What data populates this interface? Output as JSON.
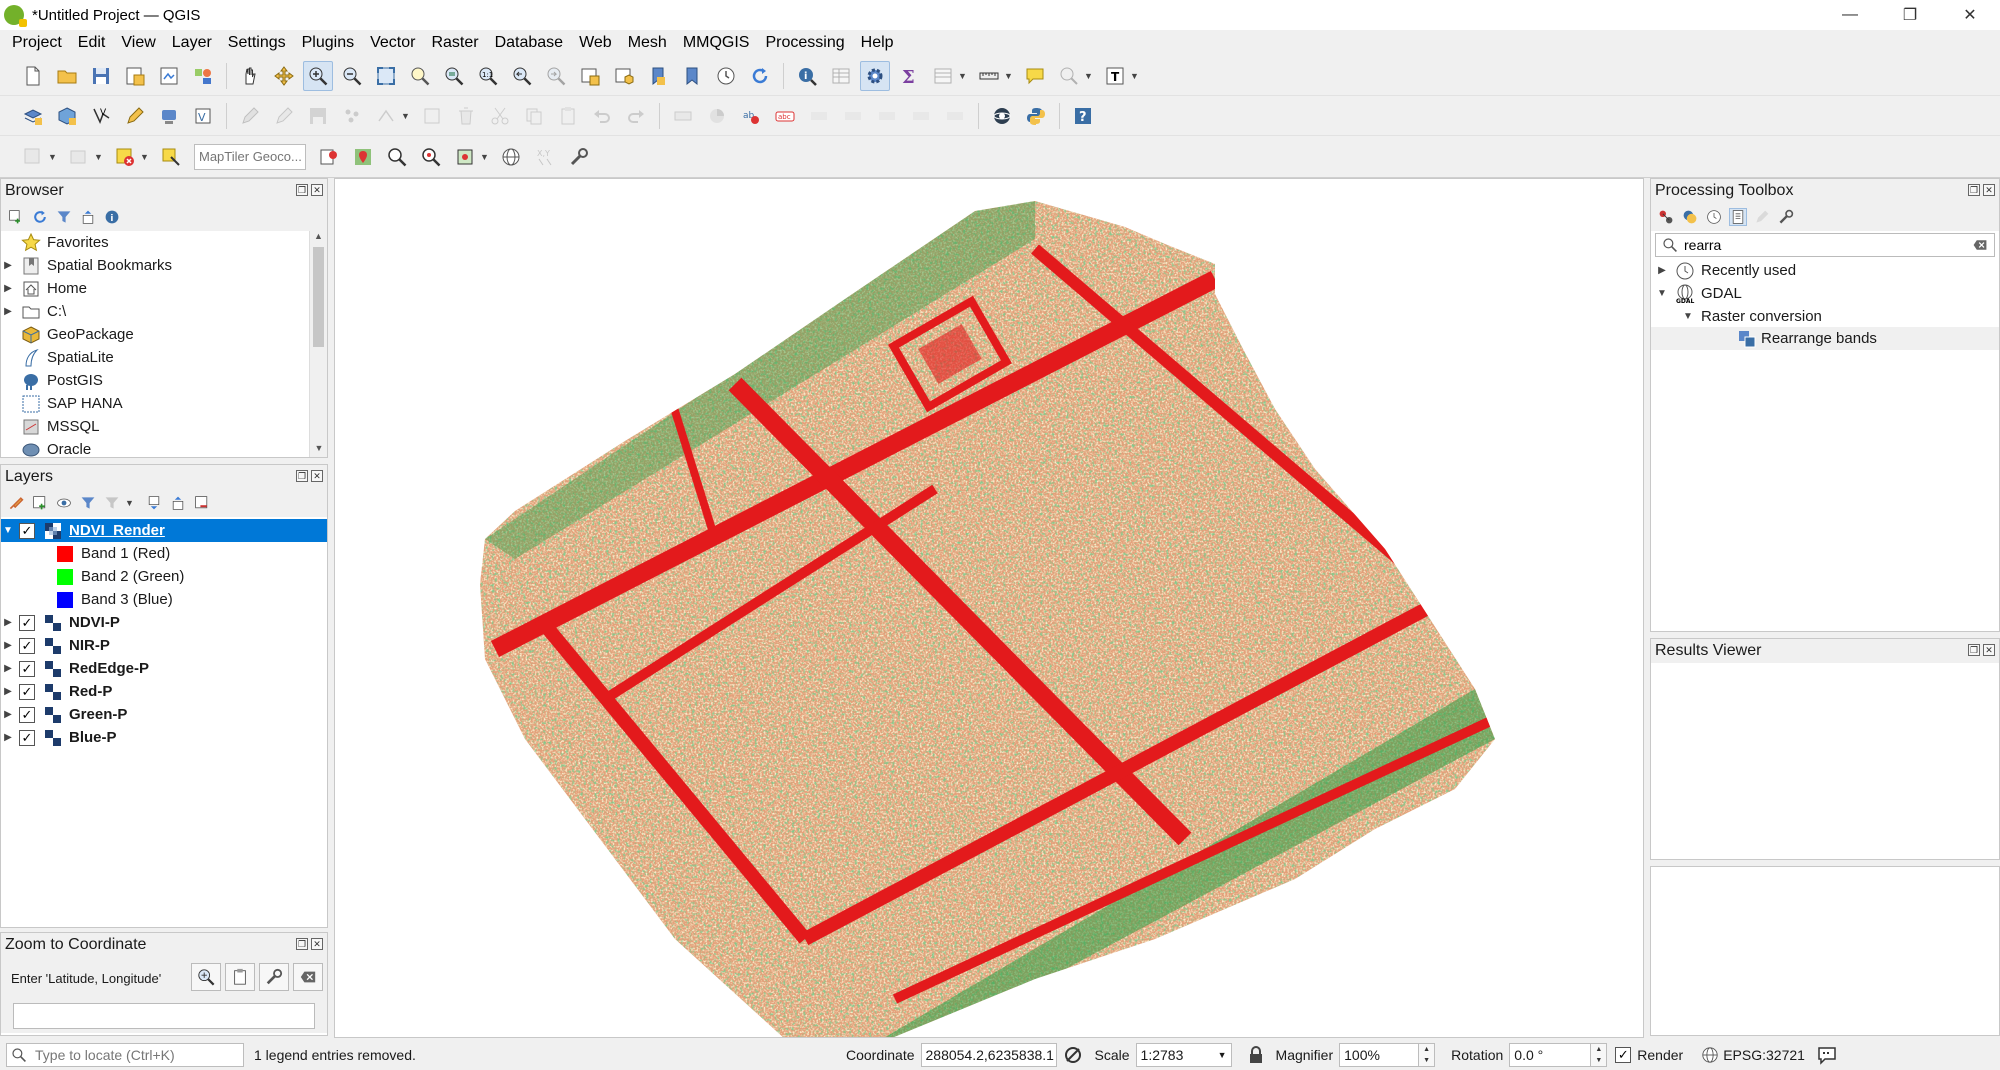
{
  "window": {
    "title": "*Untitled Project — QGIS",
    "controls": [
      "—",
      "❐",
      "✕"
    ]
  },
  "menu": [
    "Project",
    "Edit",
    "View",
    "Layer",
    "Settings",
    "Plugins",
    "Vector",
    "Raster",
    "Database",
    "Web",
    "Mesh",
    "MMQGIS",
    "Processing",
    "Help"
  ],
  "toolbar3": {
    "geocoder_placeholder": "MapTiler Geoco..."
  },
  "browser": {
    "title": "Browser",
    "items": [
      {
        "label": "Favorites",
        "icon": "star-icon",
        "expandable": false
      },
      {
        "label": "Spatial Bookmarks",
        "icon": "bookmark-icon",
        "expandable": true
      },
      {
        "label": "Home",
        "icon": "home-icon",
        "expandable": true
      },
      {
        "label": "C:\\",
        "icon": "folder-icon",
        "expandable": true
      },
      {
        "label": "GeoPackage",
        "icon": "geopackage-icon",
        "expandable": false
      },
      {
        "label": "SpatiaLite",
        "icon": "spatialite-icon",
        "expandable": false
      },
      {
        "label": "PostGIS",
        "icon": "postgis-icon",
        "expandable": false
      },
      {
        "label": "SAP HANA",
        "icon": "saphana-icon",
        "expandable": false
      },
      {
        "label": "MSSQL",
        "icon": "mssql-icon",
        "expandable": false
      },
      {
        "label": "Oracle",
        "icon": "oracle-icon",
        "expandable": false
      }
    ]
  },
  "layers": {
    "title": "Layers",
    "selected": {
      "label": "NDVI_Render"
    },
    "bands": [
      {
        "label": "Band 1 (Red)",
        "color": "#ff0000"
      },
      {
        "label": "Band 2 (Green)",
        "color": "#00ff00"
      },
      {
        "label": "Band 3 (Blue)",
        "color": "#0000ff"
      }
    ],
    "items": [
      {
        "label": "NDVI-P"
      },
      {
        "label": "NIR-P"
      },
      {
        "label": "RedEdge-P"
      },
      {
        "label": "Red-P"
      },
      {
        "label": "Green-P"
      },
      {
        "label": "Blue-P"
      }
    ]
  },
  "zoom_to_coordinate": {
    "title": "Zoom to Coordinate",
    "label": "Enter 'Latitude, Longitude'",
    "value": ""
  },
  "processing_toolbox": {
    "title": "Processing Toolbox",
    "search_value": "rearra",
    "tree": {
      "recently_used": "Recently used",
      "gdal": "GDAL",
      "raster_conversion": "Raster conversion",
      "algorithm": "Rearrange bands"
    }
  },
  "results_viewer": {
    "title": "Results Viewer"
  },
  "statusbar": {
    "locator_placeholder": "Type to locate (Ctrl+K)",
    "message": "1 legend entries removed.",
    "coordinate_label": "Coordinate",
    "coordinate_value": "288054.2,6235838.1",
    "scale_label": "Scale",
    "scale_value": "1:2783",
    "magnifier_label": "Magnifier",
    "magnifier_value": "100%",
    "rotation_label": "Rotation",
    "rotation_value": "0.0 °",
    "render_label": "Render",
    "crs": "EPSG:32721"
  },
  "colors": {
    "ndvi_low": "#e31a1c",
    "ndvi_mid": "#f3e2a0",
    "ndvi_high": "#2e9e45",
    "selection": "#0078d7"
  }
}
